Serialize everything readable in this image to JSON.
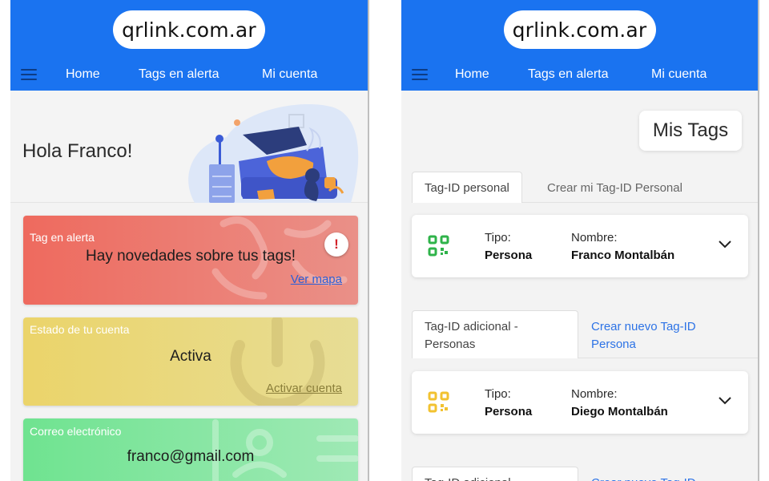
{
  "colors": {
    "brand_blue": "#1a73f0",
    "alert_red": "#ee6a5e",
    "state_yellow": "#ebd46a",
    "email_green": "#6fe390",
    "link_blue": "#2d73e6",
    "qr_green": "#2fb34a",
    "qr_yellow": "#f2c230"
  },
  "left": {
    "logo": "qrlink.com.ar",
    "nav": {
      "home": "Home",
      "alerts": "Tags en alerta",
      "account": "Mi cuenta"
    },
    "greeting": "Hola Franco!",
    "alert_card": {
      "label": "Tag en alerta",
      "message": "Hay novedades sobre tus tags!",
      "link": "Ver mapa",
      "badge": "!"
    },
    "state_card": {
      "label": "Estado de tu cuenta",
      "value": "Activa",
      "link": "Activar cuenta"
    },
    "email_card": {
      "label": "Correo electrónico",
      "value": "franco@gmail.com"
    }
  },
  "right": {
    "logo": "qrlink.com.ar",
    "nav": {
      "home": "Home",
      "alerts": "Tags en alerta",
      "account": "Mi cuenta"
    },
    "title": "Mis Tags",
    "group1": {
      "tab_active": "Tag-ID personal",
      "tab_other": "Crear mi Tag-ID Personal",
      "tag": {
        "icon": "qr-code-icon",
        "tipo_label": "Tipo:",
        "tipo_value": "Persona",
        "nombre_label": "Nombre:",
        "nombre_value": "Franco Montalbán"
      }
    },
    "group2": {
      "tab_active_line1": "Tag-ID adicional -",
      "tab_active_line2": "Personas",
      "tab_other_line1": "Crear nuevo Tag-ID",
      "tab_other_line2": "Persona",
      "tag": {
        "icon": "qr-code-icon",
        "tipo_label": "Tipo:",
        "tipo_value": "Persona",
        "nombre_label": "Nombre:",
        "nombre_value": "Diego Montalbán"
      }
    },
    "group3": {
      "tab_active": "Tag-ID adicional",
      "tab_other": "Crear nuevo Tag-ID"
    }
  }
}
